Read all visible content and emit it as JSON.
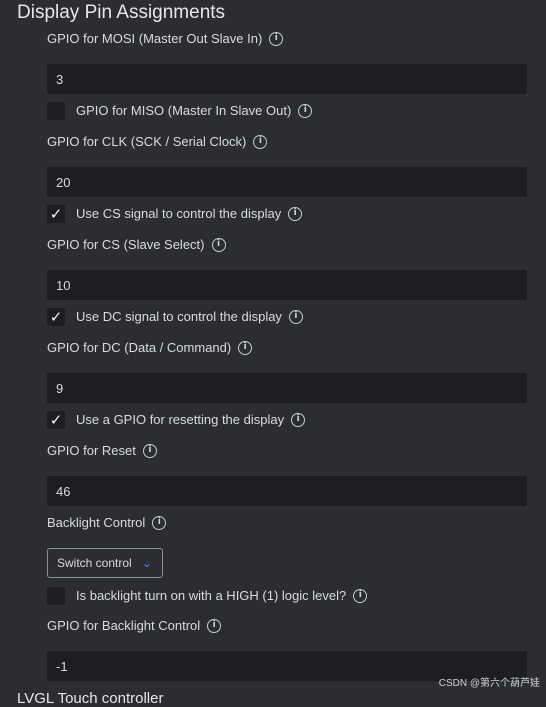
{
  "section_title": "Display Pin Assignments",
  "mosi": {
    "label": "GPIO for MOSI (Master Out Slave In)",
    "value": "3"
  },
  "miso": {
    "label": "GPIO for MISO (Master In Slave Out)",
    "checked": false
  },
  "clk": {
    "label": "GPIO for CLK (SCK / Serial Clock)",
    "value": "20"
  },
  "use_cs": {
    "label": "Use CS signal to control the display",
    "checked": true,
    "mark": "✓"
  },
  "cs": {
    "label": "GPIO for CS (Slave Select)",
    "value": "10"
  },
  "use_dc": {
    "label": "Use DC signal to control the display",
    "checked": true,
    "mark": "✓"
  },
  "dc": {
    "label": "GPIO for DC (Data / Command)",
    "value": "9"
  },
  "use_reset": {
    "label": "Use a GPIO for resetting the display",
    "checked": true,
    "mark": "✓"
  },
  "reset": {
    "label": "GPIO for Reset",
    "value": "46"
  },
  "backlight_control": {
    "label": "Backlight Control",
    "selected": "Switch control"
  },
  "backlight_high": {
    "label": "Is backlight turn on with a HIGH (1) logic level?",
    "checked": false
  },
  "backlight_gpio": {
    "label": "GPIO for Backlight Control",
    "value": "-1"
  },
  "next_section_partial": "LVGL Touch controller",
  "info_glyph": "i",
  "chevron_glyph": "⌄",
  "watermark": "CSDN @第六个葫芦娃",
  "colors": {
    "background": "#2b2d31",
    "input_bg": "#1d1e22",
    "accent": "#5b7cff",
    "text": "#d9dbe0"
  }
}
